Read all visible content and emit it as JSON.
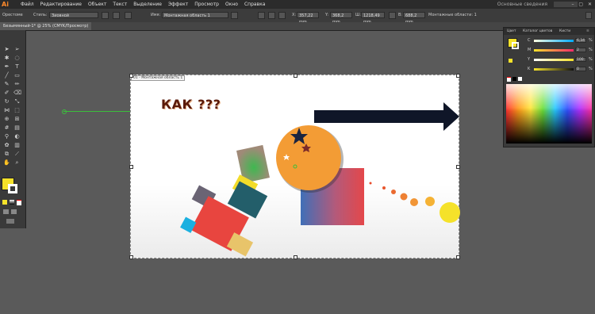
{
  "app": {
    "logo": "Ai"
  },
  "menu": [
    "Файл",
    "Редактирование",
    "Объект",
    "Текст",
    "Выделение",
    "Эффект",
    "Просмотр",
    "Окно",
    "Справка"
  ],
  "workspace": "Основные сведения",
  "control": {
    "object_type": "Орестоме",
    "style_label": "Стиль:",
    "style_value": "Зиовной",
    "name_label": "Имя:",
    "name_value": "Монтажная область 1",
    "x_label": "X:",
    "x_value": "357,22 mm",
    "y_label": "Y:",
    "y_value": "368,2 mm",
    "w_label": "Ш:",
    "w_value": "1218,49 mm",
    "h_label": "В:",
    "h_value": "688,2 mm",
    "artboards_label": "Монтажные области: 1"
  },
  "document_tab": "Безымянный-1* @ 25% (CMYK/Просмотр)",
  "artboard": {
    "label": "01 - Монтажная область 1",
    "headline": "КАК ???"
  },
  "colors": {
    "accent_orange": "#f39c35",
    "fill_yellow": "#f5e22a",
    "arrow_navy": "#0f1628",
    "guide_green": "#3bbf3b"
  },
  "color_panel": {
    "tabs": [
      "Цвет",
      "Каталог цветов",
      "Кисти"
    ],
    "channels": [
      {
        "label": "C",
        "value": "6,34"
      },
      {
        "label": "M",
        "value": "2"
      },
      {
        "label": "Y",
        "value": "100"
      },
      {
        "label": "K",
        "value": "0"
      }
    ],
    "percent": "%"
  },
  "icons": [
    "selection-tool",
    "direct-selection-tool",
    "magic-wand",
    "lasso",
    "pen",
    "type",
    "line",
    "rectangle",
    "paintbrush",
    "pencil",
    "eraser",
    "rotate",
    "scale",
    "width",
    "warp",
    "free-transform",
    "shape-builder",
    "perspective",
    "mesh",
    "gradient",
    "eyedropper",
    "blend",
    "symbol",
    "graph",
    "artboard",
    "slice",
    "hand",
    "zoom"
  ]
}
